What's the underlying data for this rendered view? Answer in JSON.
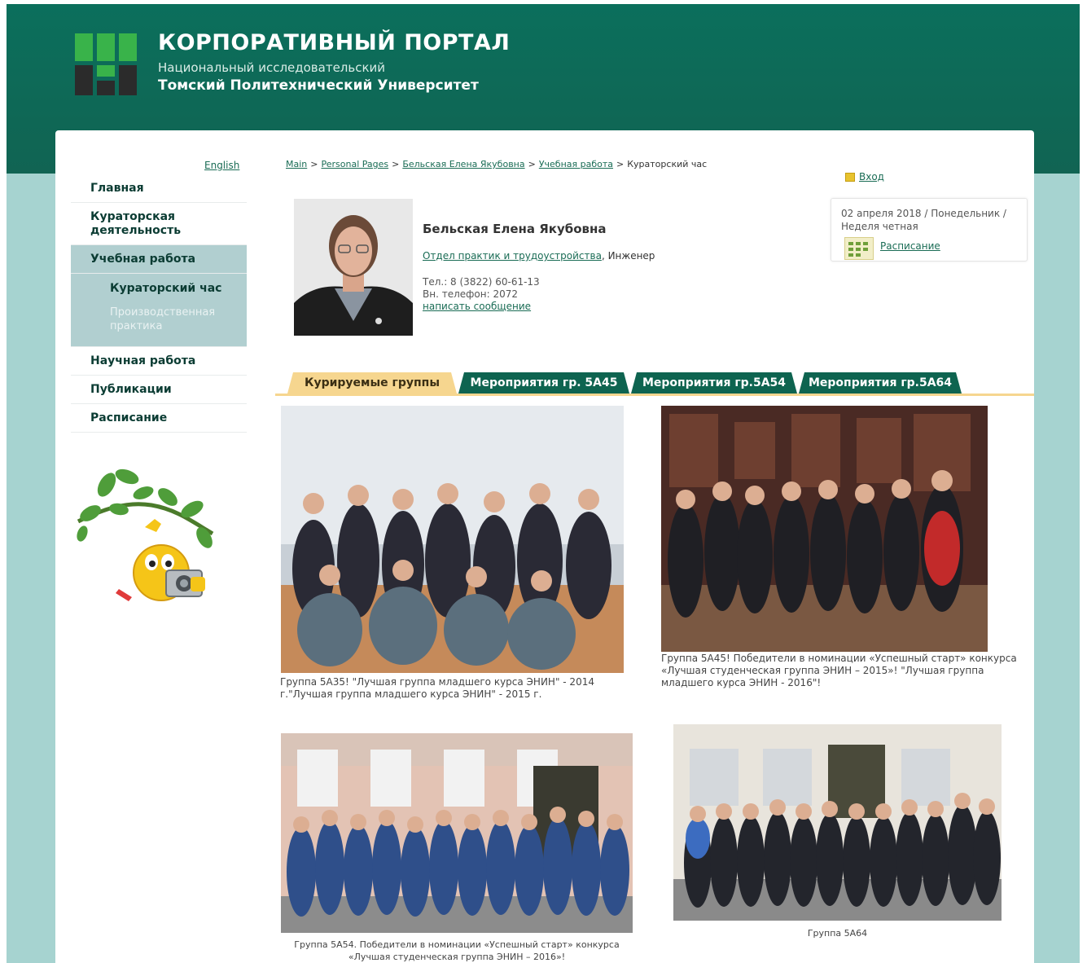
{
  "brand": {
    "title": "КОРПОРАТИВНЫЙ ПОРТАЛ",
    "subtitle": "Национальный исследовательский",
    "university": "Томский Политехнический Университет",
    "colors": {
      "header": "#0f6755",
      "background": "#a6d3d0",
      "logo_green": "#39b34a",
      "logo_dark": "#2b2b2b"
    }
  },
  "lang_link": "English",
  "nav": {
    "items": [
      {
        "label": "Главная"
      },
      {
        "label": "Кураторская деятельность"
      },
      {
        "label": "Учебная работа"
      },
      {
        "label": "Научная работа"
      },
      {
        "label": "Публикации"
      },
      {
        "label": "Расписание"
      }
    ],
    "sub_items": [
      {
        "label": "Кураторский час"
      },
      {
        "label": "Производственная практика"
      }
    ]
  },
  "breadcrumb": {
    "items": [
      "Main",
      "Personal Pages",
      "Бельская Елена Якубовна",
      "Учебная работа"
    ],
    "current": "Кураторский час",
    "separator": ">"
  },
  "login": {
    "label": "Вход"
  },
  "date_box": {
    "text": "02 апреля 2018 / Понедельник / Неделя четная",
    "schedule_link": "Расписание"
  },
  "profile": {
    "name": "Бельская Елена Якубовна",
    "department": "Отдел практик и трудоустройства",
    "position": ", Инженер",
    "phone": "Тел.: 8 (3822) 60-61-13",
    "internal_phone": "Вн. телефон: 2072",
    "message_link": "написать сообщение"
  },
  "tabs": [
    {
      "label": "Курируемые группы",
      "active": true
    },
    {
      "label": "Мероприятия гр. 5А45",
      "active": false
    },
    {
      "label": "Мероприятия гр.5А54",
      "active": false
    },
    {
      "label": "Мероприятия гр.5А64",
      "active": false
    }
  ],
  "gallery": [
    {
      "caption": "Группа 5А35! \"Лучшая группа младшего курса ЭНИН\" - 2014 г.\"Лучшая группа младшего курса ЭНИН\" - 2015 г."
    },
    {
      "caption": "Группа 5А45! Победители в номинации «Успешный старт» конкурса «Лучшая студенческая группа ЭНИН – 2015»! \"Лучшая группа младшего курса ЭНИН - 2016\"!"
    },
    {
      "caption": "Группа 5А54. Победители в номинации «Успешный старт» конкурса «Лучшая студенческая группа ЭНИН – 2016»!"
    },
    {
      "caption": "Группа 5А64"
    }
  ]
}
